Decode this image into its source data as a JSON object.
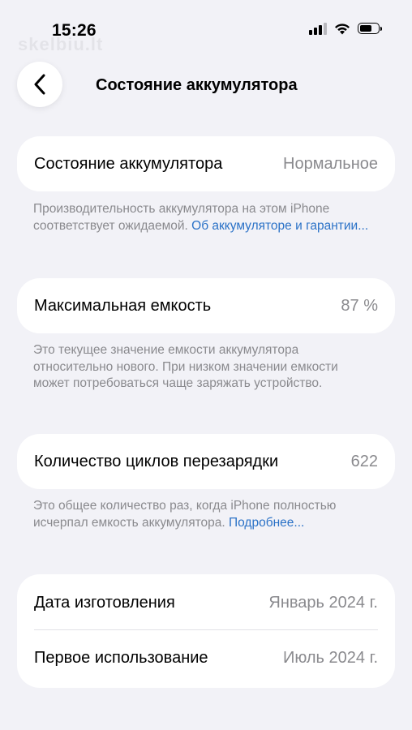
{
  "status_bar": {
    "time": "15:26",
    "watermark": "skelbiu.lt"
  },
  "nav": {
    "title": "Состояние аккумулятора"
  },
  "sections": {
    "health": {
      "label": "Состояние аккумулятора",
      "value": "Нормальное",
      "footnote_text": "Производительность аккумулятора на этом iPhone соответствует ожидаемой. ",
      "footnote_link": "Об аккумуляторе и гарантии..."
    },
    "capacity": {
      "label": "Максимальная емкость",
      "value": "87 %",
      "footnote_text": "Это текущее значение емкости аккумулятора относительно нового. При низком значении емкости может потребоваться чаще заряжать устройство."
    },
    "cycles": {
      "label": "Количество циклов перезарядки",
      "value": "622",
      "footnote_text": "Это общее количество раз, когда iPhone полностью исчерпал емкость аккумулятора. ",
      "footnote_link": "Подробнее..."
    },
    "dates": {
      "manufacture_label": "Дата изготовления",
      "manufacture_value": "Январь 2024 г.",
      "first_use_label": "Первое использование",
      "first_use_value": "Июль 2024 г."
    }
  },
  "colors": {
    "background": "#f2f2f7",
    "card": "#ffffff",
    "link": "#2b72c7",
    "secondary_text": "#8a8a8e"
  }
}
